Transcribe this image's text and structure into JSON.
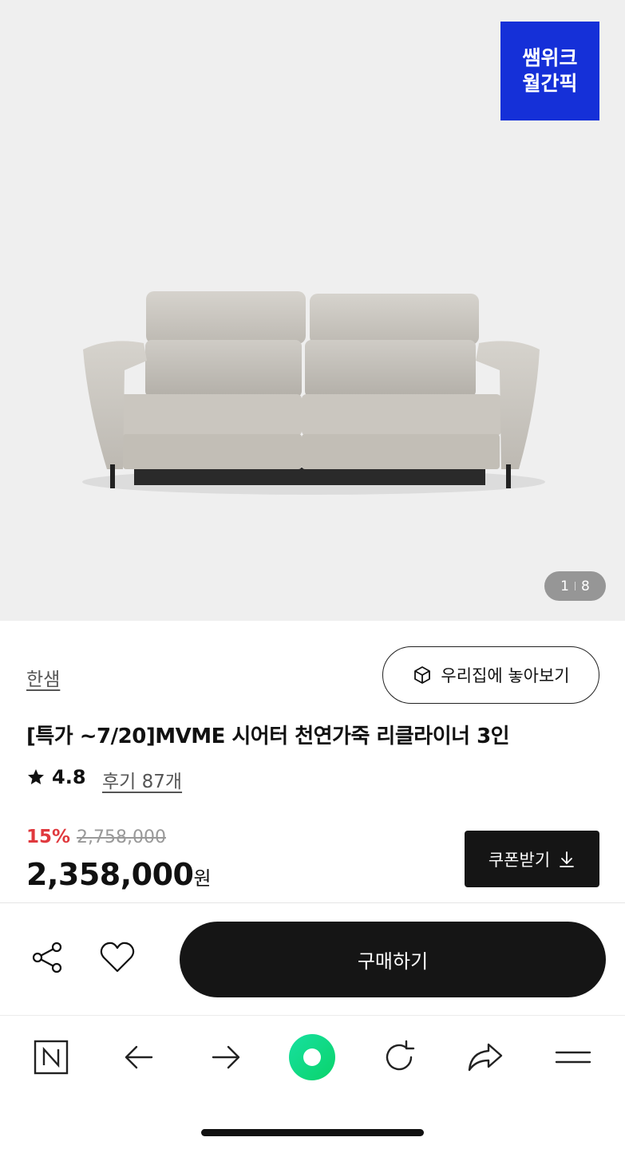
{
  "hero": {
    "badge_line1": "쌤위크",
    "badge_line2": "월간픽",
    "counter_current": "1",
    "counter_total": "8",
    "badge_color": "#1530d8"
  },
  "product": {
    "brand": "한샘",
    "ar_button_label": "우리집에 놓아보기",
    "title": "[특가 ~7/20]MVME 시어터 천연가죽 리클라이너 3인",
    "rating": "4.8",
    "reviews_label": "후기 87개",
    "discount": "15%",
    "original_price": "2,758,000",
    "price": "2,358,000",
    "price_unit": "원",
    "coupon_label": "쿠폰받기"
  },
  "actions": {
    "buy_label": "구매하기",
    "accent_discount_color": "#e0393e"
  },
  "browser_bar": {
    "icons": [
      "naver-n-icon",
      "back-arrow-icon",
      "forward-arrow-icon",
      "green-dot-icon",
      "refresh-icon",
      "share-arrow-icon",
      "menu-icon"
    ]
  }
}
